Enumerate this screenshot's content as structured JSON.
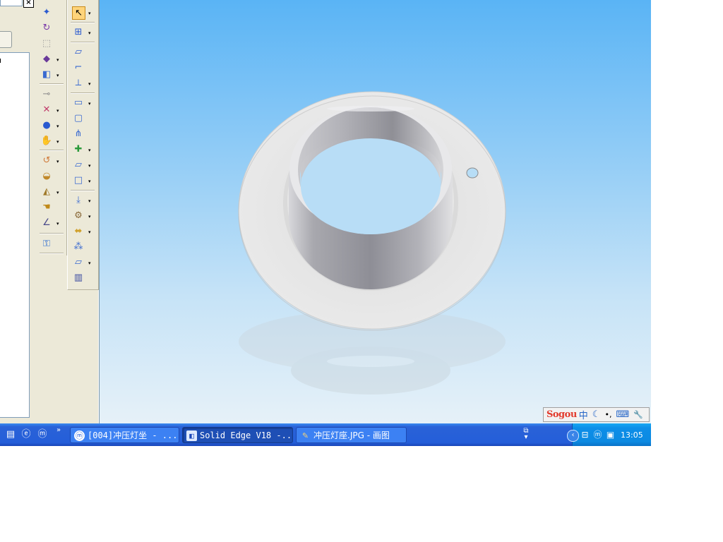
{
  "left_panel": {
    "close_glyph": "×"
  },
  "toolbar_a": {
    "tools": [
      {
        "name": "pin-icon",
        "glyph": "✦"
      },
      {
        "name": "rotate-icon",
        "glyph": "↻"
      },
      {
        "name": "dashed-box-icon",
        "glyph": "⬚"
      },
      {
        "name": "tilt-cube-icon",
        "glyph": "◆"
      },
      {
        "name": "cube-split-icon",
        "glyph": "◧"
      },
      {
        "name": "hinge-icon",
        "glyph": "⊸"
      },
      {
        "name": "cross-out-icon",
        "glyph": "✕"
      },
      {
        "name": "blue-sphere-icon",
        "glyph": "●"
      },
      {
        "name": "gray-hand-icon",
        "glyph": "✋"
      },
      {
        "name": "revolve-icon",
        "glyph": "↺"
      },
      {
        "name": "sweep-icon",
        "glyph": "◒"
      },
      {
        "name": "loft-icon",
        "glyph": "◭"
      },
      {
        "name": "hand-icon",
        "glyph": "☚"
      },
      {
        "name": "angle-icon",
        "glyph": "∠"
      },
      {
        "name": "wizard-icon",
        "glyph": "⚿"
      }
    ]
  },
  "toolbar_b": {
    "tools": [
      {
        "name": "select-arrow-icon",
        "glyph": "↖"
      },
      {
        "name": "sketch-grid-icon",
        "glyph": "⊞"
      },
      {
        "name": "plane-icon",
        "glyph": "▱"
      },
      {
        "name": "flange-icon",
        "glyph": "⌐"
      },
      {
        "name": "bend-icon",
        "glyph": "⟂"
      },
      {
        "name": "tab-icon",
        "glyph": "▭"
      },
      {
        "name": "cutout-icon",
        "glyph": "▢"
      },
      {
        "name": "emboss-icon",
        "glyph": "⋔"
      },
      {
        "name": "add-feature-icon",
        "glyph": "✚"
      },
      {
        "name": "face-icon",
        "glyph": "▱"
      },
      {
        "name": "square-icon",
        "glyph": "□"
      },
      {
        "name": "punch-icon",
        "glyph": "⤓"
      },
      {
        "name": "dimple-icon",
        "glyph": "⚙"
      },
      {
        "name": "mirror-icon",
        "glyph": "⬌"
      },
      {
        "name": "pattern-icon",
        "glyph": "⁂"
      },
      {
        "name": "sheet-icon",
        "glyph": "▱"
      },
      {
        "name": "bars-icon",
        "glyph": "▥"
      }
    ]
  },
  "ime": {
    "logo": "Sogou",
    "lang": "中",
    "moon": "☾",
    "punct": "•,",
    "keyboard": "⌨",
    "tools": "🔧"
  },
  "taskbar": {
    "quicklaunch": [
      {
        "name": "show-desktop-icon",
        "glyph": "▤"
      },
      {
        "name": "ie-icon",
        "glyph": "ⓔ"
      },
      {
        "name": "maxthon-icon",
        "glyph": "ⓜ"
      }
    ],
    "more": "»",
    "tasks": [
      {
        "label": "[004]冲压灯坐 - ...",
        "icon": "ⓜ",
        "color": "#ffffff",
        "icon_color": "#2a62d8"
      },
      {
        "label": "Solid Edge V18 -...",
        "icon": "◧",
        "color": "#dfeaff",
        "icon_color": "#1a46b8"
      },
      {
        "label": "冲压灯座.JPG - 画图",
        "icon": "✎",
        "color": "#f1d27a",
        "icon_color": "#6a4a10"
      }
    ],
    "restore": "⧉",
    "tray_chevron": "‹",
    "tray_icons": [
      {
        "name": "network-icon",
        "glyph": "⊟"
      },
      {
        "name": "maxthon-tray-icon",
        "glyph": "ⓜ"
      },
      {
        "name": "display-icon",
        "glyph": "▣"
      }
    ],
    "clock": "13:05"
  }
}
